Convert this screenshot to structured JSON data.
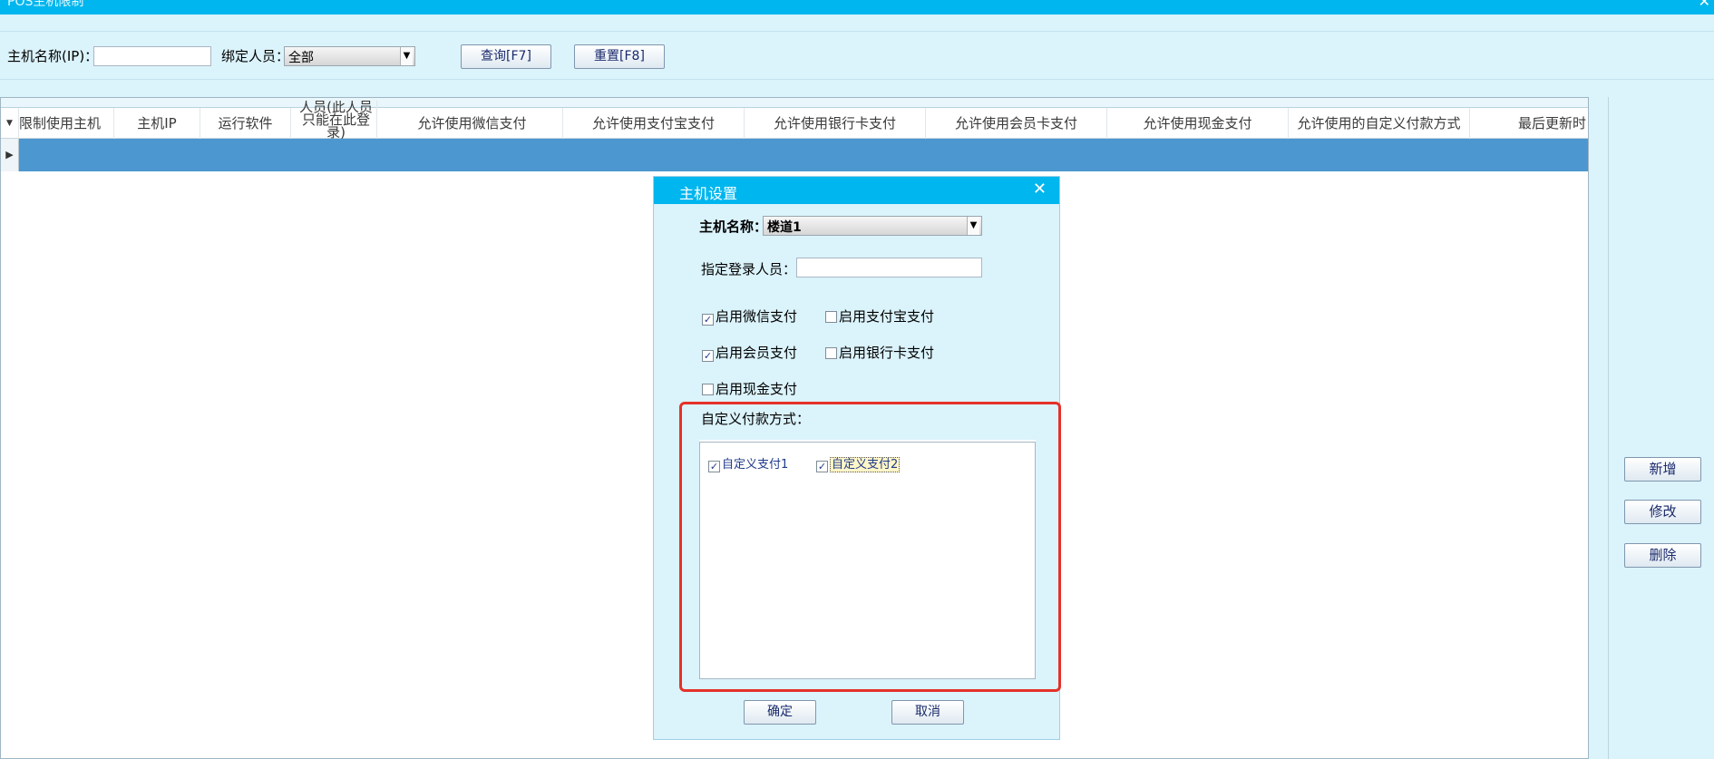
{
  "window": {
    "title": "POS主机限制",
    "close_glyph": "✕"
  },
  "toolbar": {
    "host_label": "主机名称(IP)：",
    "host_value": "",
    "user_label": "绑定人员：",
    "user_value": "全部",
    "query_label": "查询[F7]",
    "reset_label": "重置[F8]"
  },
  "table": {
    "columns": [
      "限制使用主机",
      "主机IP",
      "运行软件",
      "人员(此人员只能在此登录)",
      "允许使用微信支付",
      "允许使用支付宝支付",
      "允许使用银行卡支付",
      "允许使用会员卡支付",
      "允许使用现金支付",
      "允许使用的自定义付款方式",
      "最后更新时"
    ]
  },
  "side": {
    "add": "新增",
    "edit": "修改",
    "delete": "删除"
  },
  "dialog": {
    "title": "主机设置",
    "close": "✕",
    "host_label": "主机名称：",
    "host_value": "楼道1",
    "login_label": "指定登录人员：",
    "login_value": "",
    "options": [
      {
        "label": "启用微信支付",
        "checked": true
      },
      {
        "label": "启用支付宝支付",
        "checked": false
      },
      {
        "label": "启用会员支付",
        "checked": true
      },
      {
        "label": "启用银行卡支付",
        "checked": false
      },
      {
        "label": "启用现金支付",
        "checked": false
      }
    ],
    "custom_label": "自定义付款方式：",
    "custom_items": [
      {
        "label": "自定义支付1",
        "checked": true
      },
      {
        "label": "自定义支付2",
        "checked": true
      }
    ],
    "ok": "确定",
    "cancel": "取消"
  },
  "colors": {
    "titlebar": "#00b6ee",
    "selected_row": "#4c97cf",
    "highlight": "#e5312a"
  }
}
